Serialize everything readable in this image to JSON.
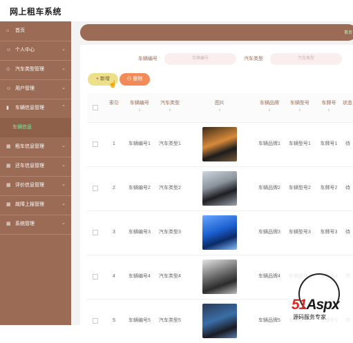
{
  "app": {
    "title": "网上租车系统"
  },
  "sidebar": {
    "items": [
      {
        "icon": "home-icon",
        "glyph": "⌂",
        "label": "首页"
      },
      {
        "icon": "user-icon",
        "glyph": "☺",
        "label": "个人中心"
      },
      {
        "icon": "shield-icon",
        "glyph": "◇",
        "label": "汽车类型管理"
      },
      {
        "icon": "user-icon",
        "glyph": "☺",
        "label": "用户管理"
      },
      {
        "icon": "bar-chart-icon",
        "glyph": "▮",
        "label": "车辆信息管理"
      },
      {
        "icon": "grid-icon",
        "glyph": "▦",
        "label": "租车信息管理"
      },
      {
        "icon": "grid-icon",
        "glyph": "▦",
        "label": "还车信息管理"
      },
      {
        "icon": "grid-icon",
        "glyph": "▦",
        "label": "评价信息管理"
      },
      {
        "icon": "grid-icon",
        "glyph": "▦",
        "label": "故障上报管理"
      },
      {
        "icon": "grid-icon",
        "glyph": "▦",
        "label": "系统管理"
      }
    ],
    "submenu_label": "车辆信息"
  },
  "breadcrumb": {
    "text": "首页"
  },
  "search": {
    "car_no_label": "车辆编号",
    "car_no_placeholder": "车辆编号",
    "car_type_label": "汽车类型",
    "car_type_placeholder": "汽车类型"
  },
  "toolbar": {
    "add_label": "+ 新增",
    "delete_label": "⊖ 删除"
  },
  "table": {
    "headers": {
      "index": "索引",
      "car_no": "车辆编号",
      "car_type": "汽车类型",
      "photo": "图片",
      "brand": "车辆品牌",
      "model": "车辆型号",
      "plate": "车牌号",
      "status": "状态"
    },
    "sort_glyph": "⇕",
    "rows": [
      {
        "index": "1",
        "car_no": "车辆编号1",
        "car_type": "汽车类型1",
        "brand": "车辆品牌1",
        "model": "车辆型号1",
        "plate": "车牌号1",
        "status": "待"
      },
      {
        "index": "2",
        "car_no": "车辆编号2",
        "car_type": "汽车类型2",
        "brand": "车辆品牌2",
        "model": "车辆型号2",
        "plate": "车牌号2",
        "status": "待"
      },
      {
        "index": "3",
        "car_no": "车辆编号3",
        "car_type": "汽车类型3",
        "brand": "车辆品牌3",
        "model": "车辆型号3",
        "plate": "车牌号3",
        "status": "待"
      },
      {
        "index": "4",
        "car_no": "车辆编号4",
        "car_type": "汽车类型4",
        "brand": "车辆品牌4",
        "model": "车辆型号4",
        "plate": "车牌号4",
        "status": "待"
      },
      {
        "index": "5",
        "car_no": "车辆编号5",
        "car_type": "汽车类型5",
        "brand": "车辆品牌5",
        "model": "车辆型号5",
        "plate": "车牌号5",
        "status": "待"
      }
    ]
  },
  "watermark": {
    "logo_left": "51",
    "logo_right": "Aspx",
    "subtitle": "源码服务专家"
  },
  "colors": {
    "sidebar": "#9b6b55",
    "accent_green": "#7df2a0",
    "add_button": "#ece08a",
    "delete_button": "#f48a57"
  }
}
